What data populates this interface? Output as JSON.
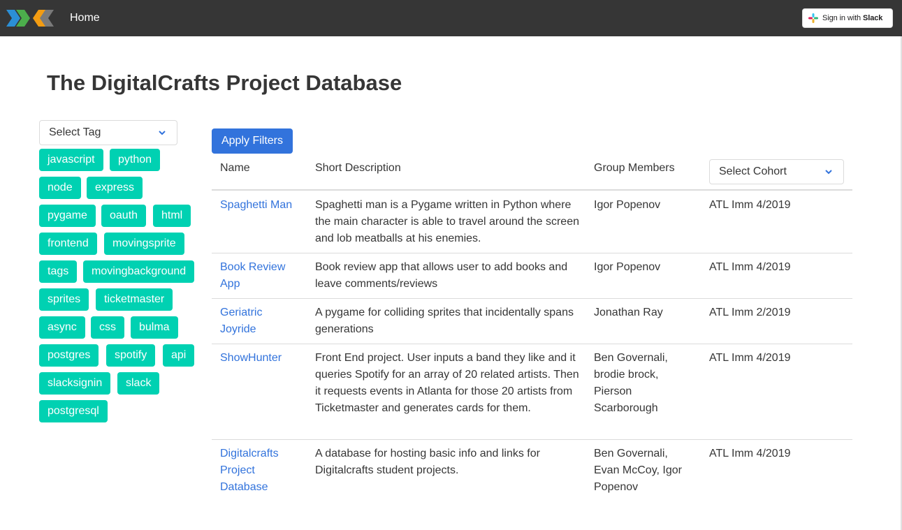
{
  "navbar": {
    "home_label": "Home",
    "slack": {
      "prefix": "Sign in with ",
      "brand": "Slack"
    }
  },
  "page": {
    "title": "The DigitalCrafts Project Database"
  },
  "filters": {
    "tag_select": "Select Tag",
    "apply_label": "Apply Filters",
    "cohort_select": "Select Cohort",
    "tags": [
      "javascript",
      "python",
      "node",
      "express",
      "pygame",
      "oauth",
      "html",
      "frontend",
      "movingsprite",
      "tags",
      "movingbackground",
      "sprites",
      "ticketmaster",
      "async",
      "css",
      "bulma",
      "postgres",
      "spotify",
      "api",
      "slacksignin",
      "slack",
      "postgresql"
    ]
  },
  "table": {
    "headers": {
      "name": "Name",
      "description": "Short Description",
      "members": "Group Members"
    },
    "rows": [
      {
        "name": "Spaghetti Man",
        "description": "Spaghetti man is a Pygame written in Python where the main character is able to travel around the screen and lob meatballs at his enemies.",
        "members": "Igor Popenov",
        "cohort": "ATL Imm 4/2019"
      },
      {
        "name": "Book Review App",
        "description": "Book review app that allows user to add books and leave comments/reviews",
        "members": "Igor Popenov",
        "cohort": "ATL Imm 4/2019"
      },
      {
        "name": "Geriatric Joyride",
        "description": "A pygame for colliding sprites that incidentally spans generations",
        "members": "Jonathan Ray",
        "cohort": "ATL Imm 2/2019"
      },
      {
        "name": "ShowHunter",
        "description": "Front End project. User inputs a band they like and it queries Spotify for an array of 20 related artists. Then it requests events in Atlanta for those 20 artists from Ticketmaster and generates cards for them.",
        "members": "Ben Governali, brodie brock, Pierson Scarborough",
        "cohort": "ATL Imm 4/2019"
      },
      {
        "name": "Digitalcrafts Project Database",
        "description": "A database for hosting basic info and links for Digitalcrafts student projects.",
        "members": "Ben Governali, Evan McCoy, Igor Popenov",
        "cohort": "ATL Imm 4/2019"
      }
    ]
  },
  "colors": {
    "navbar": "#363636",
    "tag": "#00d1b2",
    "primary": "#3273dc",
    "link": "#3273dc"
  },
  "icons": {
    "logo": "digitalcrafts-logo-icon",
    "slack": "slack-icon",
    "dropdown": "chevron-down-icon"
  }
}
